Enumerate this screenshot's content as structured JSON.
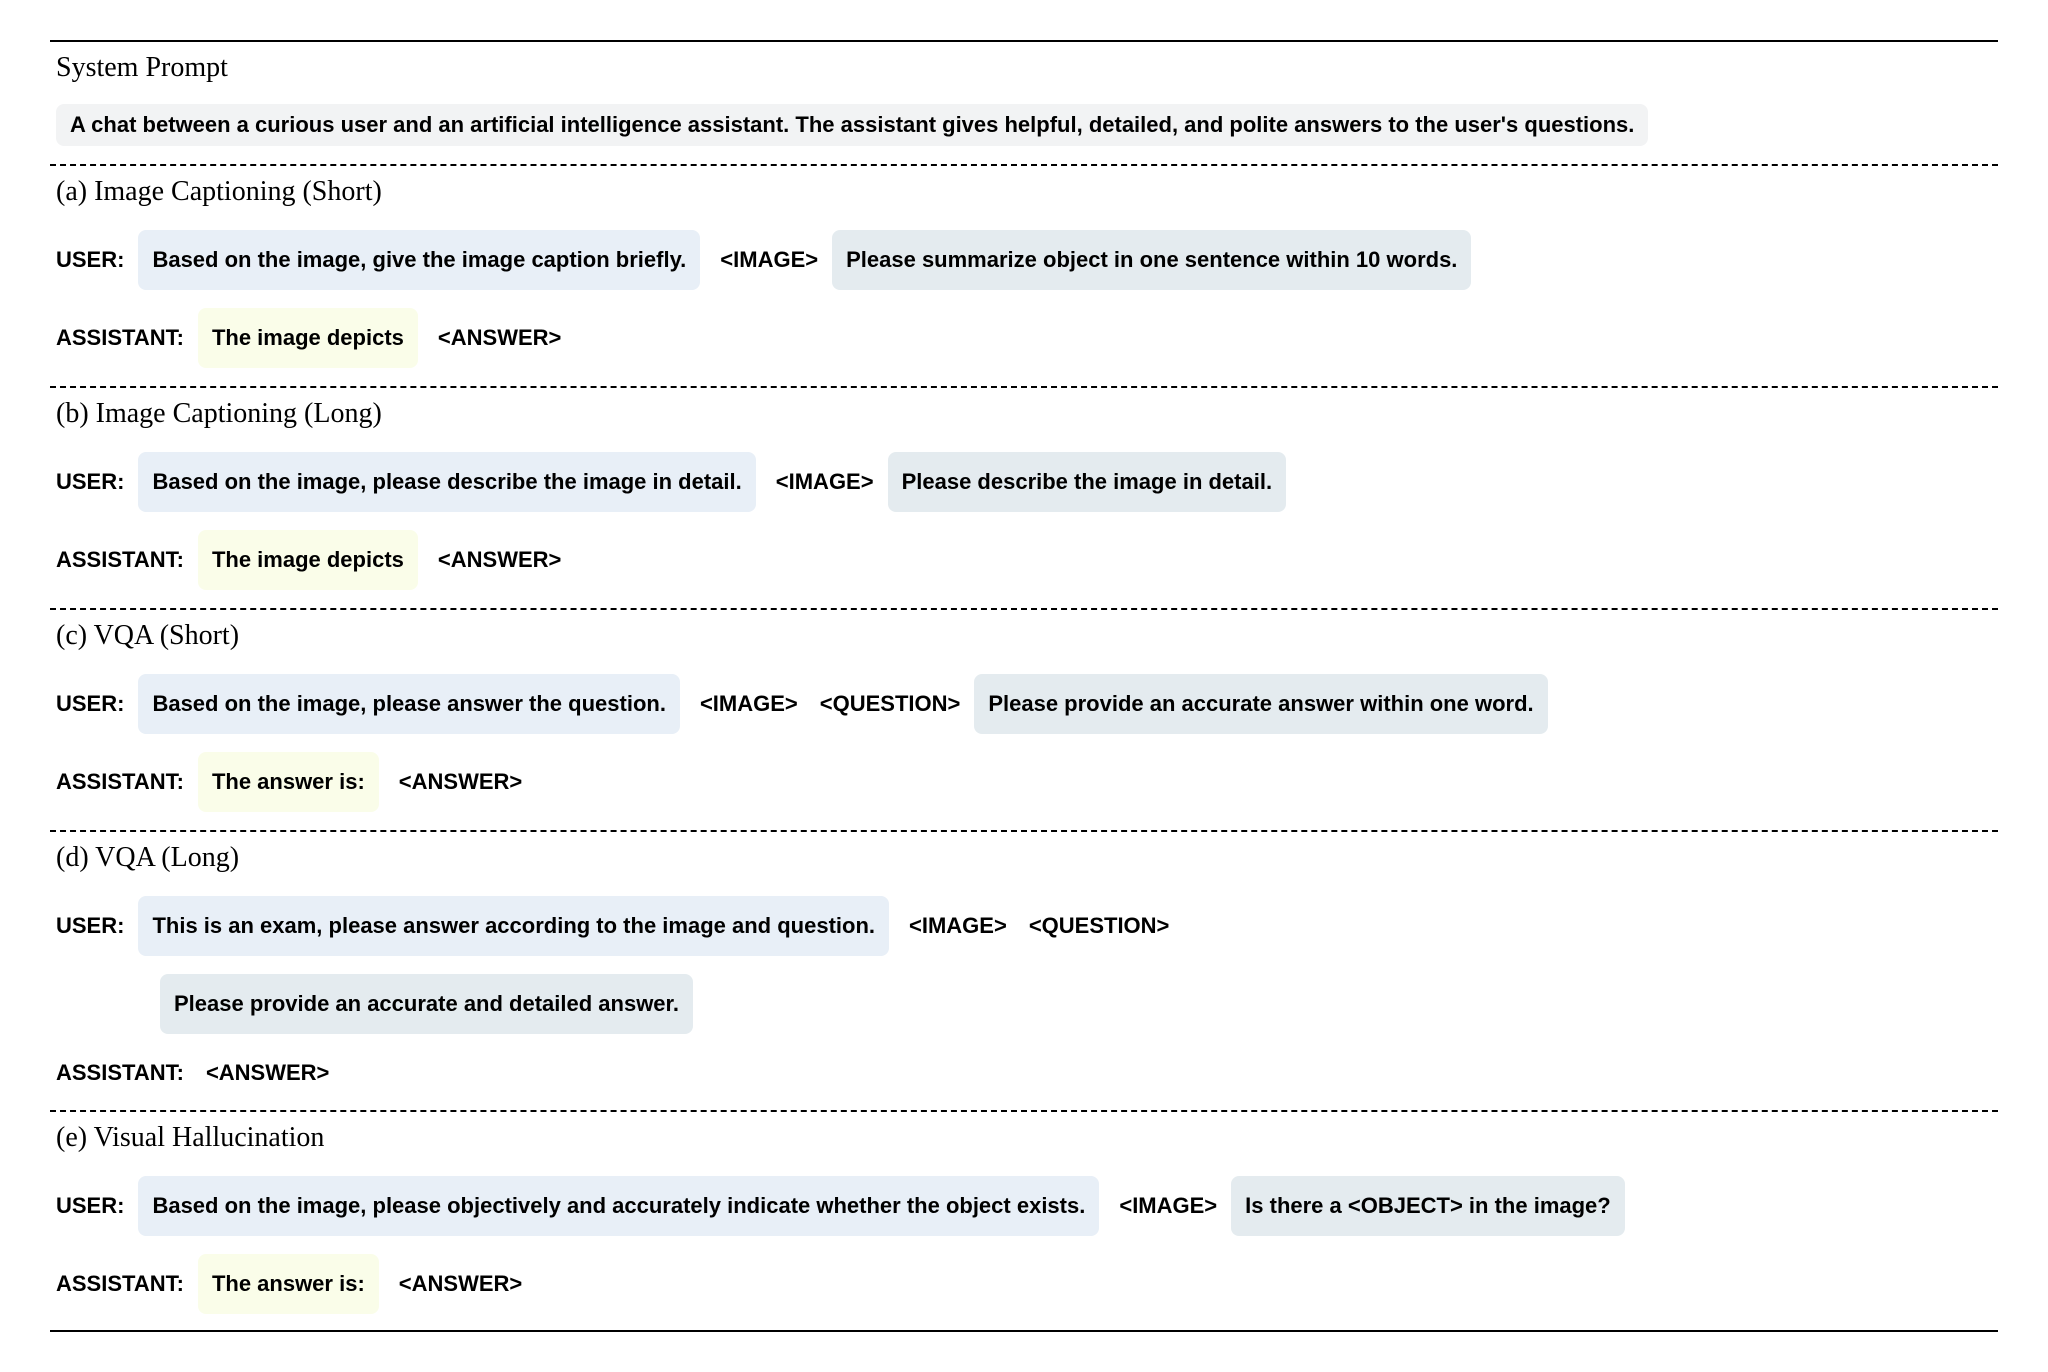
{
  "header": {
    "system_prompt_label": "System Prompt",
    "system_prompt_text": "A chat between a curious user and an artificial intelligence assistant. The assistant gives helpful, detailed, and polite answers to the user's questions."
  },
  "roles": {
    "user": "USER:",
    "assistant": "ASSISTANT:"
  },
  "tokens": {
    "image": "<IMAGE>",
    "question": "<QUESTION>",
    "answer": "<ANSWER>",
    "object": "<OBJECT>"
  },
  "sections": {
    "a": {
      "title": "(a) Image Captioning (Short)",
      "user_prefix": "Based on the image, give the image caption briefly.",
      "user_suffix": "Please summarize object in one sentence within 10 words.",
      "assistant_prefix": "The image depicts"
    },
    "b": {
      "title": "(b) Image Captioning (Long)",
      "user_prefix": "Based on the image, please describe the image in detail.",
      "user_suffix": "Please describe the image in detail.",
      "assistant_prefix": "The image depicts"
    },
    "c": {
      "title": "(c) VQA (Short)",
      "user_prefix": "Based on the image, please answer the question.",
      "user_suffix": "Please provide an accurate answer within one word.",
      "assistant_prefix": "The answer is:"
    },
    "d": {
      "title": "(d) VQA (Long)",
      "user_prefix": "This is an exam, please answer according to the image and question.",
      "user_suffix": "Please provide an accurate and detailed answer."
    },
    "e": {
      "title": "(e) Visual Hallucination",
      "user_prefix": "Based on the image, please objectively and accurately indicate whether the object exists.",
      "user_suffix_pre": "Is there a ",
      "user_suffix_post": " in the image?",
      "assistant_prefix": "The answer is:"
    }
  }
}
